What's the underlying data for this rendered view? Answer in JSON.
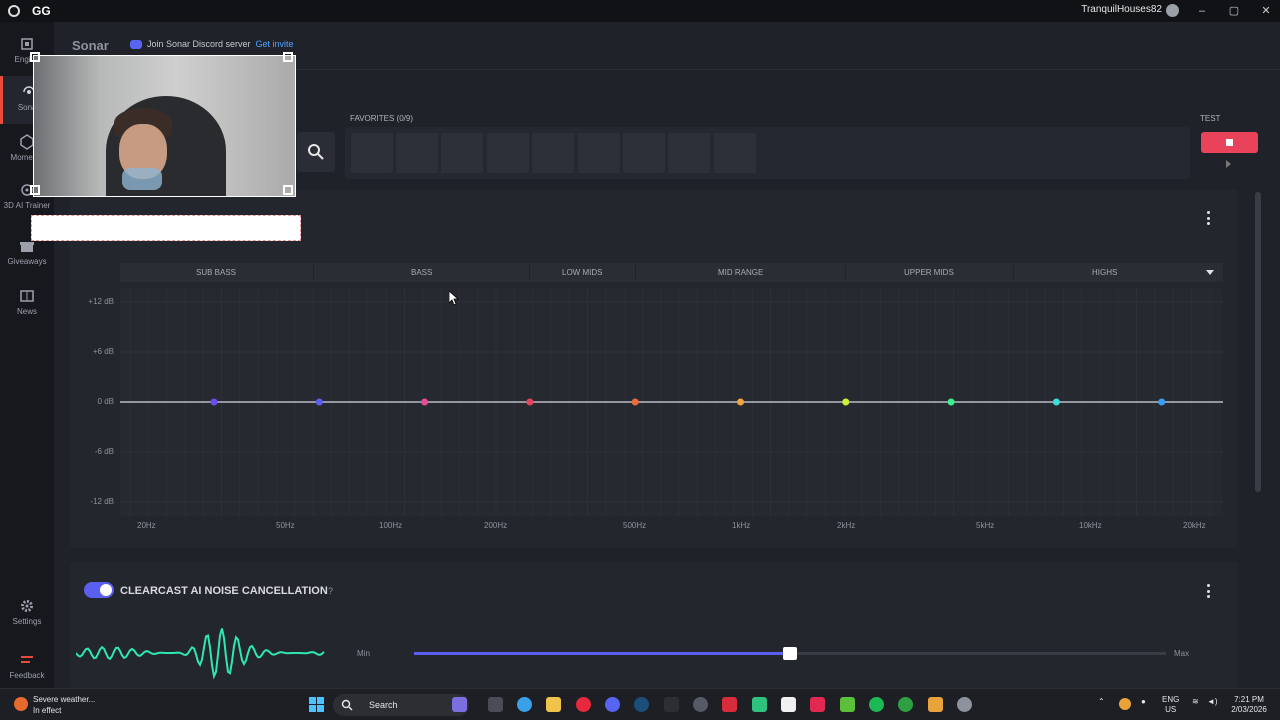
{
  "titlebar": {
    "app": "GG",
    "username": "TranquilHouses82",
    "minimize": "–",
    "maximize": "▢",
    "close": "✕"
  },
  "sidebar": {
    "items": [
      {
        "label": "Engine",
        "icon": "chip-icon"
      },
      {
        "label": "Sonar",
        "icon": "sonar-icon",
        "active": true
      },
      {
        "label": "Moments",
        "icon": "moments-icon"
      },
      {
        "label": "3D AI Trainer",
        "icon": "trainer-icon"
      },
      {
        "label": "Giveaways",
        "icon": "gift-icon"
      },
      {
        "label": "News",
        "icon": "news-icon"
      }
    ],
    "settings": "Settings",
    "feedback": "Feedback"
  },
  "header": {
    "title": "Sonar",
    "discord_text": "Join Sonar Discord server",
    "discord_link": "Get invite"
  },
  "favorites": {
    "label": "FAVORITES (0/9)",
    "slots": 9
  },
  "test": {
    "label": "TEST"
  },
  "equalizer": {
    "bands": [
      "SUB BASS",
      "BASS",
      "LOW MIDS",
      "MID RANGE",
      "UPPER MIDS",
      "HIGHS"
    ],
    "db_ticks": [
      "+12 dB",
      "+6 dB",
      "0 dB",
      "-6 dB",
      "-12 dB"
    ],
    "hz_ticks": [
      "20Hz",
      "50Hz",
      "100Hz",
      "200Hz",
      "500Hz",
      "1kHz",
      "2kHz",
      "5kHz",
      "10kHz",
      "20kHz"
    ],
    "points": [
      {
        "gain_db": 0,
        "color": "#6c4cf0"
      },
      {
        "gain_db": 0,
        "color": "#5b5ff0"
      },
      {
        "gain_db": 0,
        "color": "#e64b9a"
      },
      {
        "gain_db": 0,
        "color": "#e8435a"
      },
      {
        "gain_db": 0,
        "color": "#ef6a3a"
      },
      {
        "gain_db": 0,
        "color": "#f2a43a"
      },
      {
        "gain_db": 0,
        "color": "#c9f23a"
      },
      {
        "gain_db": 0,
        "color": "#3af08c"
      },
      {
        "gain_db": 0,
        "color": "#3ae0d8"
      },
      {
        "gain_db": 0,
        "color": "#3a9cf2"
      }
    ]
  },
  "noise_cancel": {
    "title": "CLEARCAST AI NOISE CANCELLATION",
    "help": "?",
    "enabled": true,
    "min_label": "Min",
    "max_label": "Max",
    "level": 0.5
  },
  "taskbar": {
    "weather_title": "Severe weather...",
    "weather_sub": "In effect",
    "search": "Search",
    "lang_top": "ENG",
    "lang_bottom": "US",
    "time": "7:21 PM",
    "date": "2/03/2026"
  },
  "colors": {
    "accent": "#5b5ff0",
    "test_red": "#e8435a",
    "wave": "#2ee8b0"
  }
}
